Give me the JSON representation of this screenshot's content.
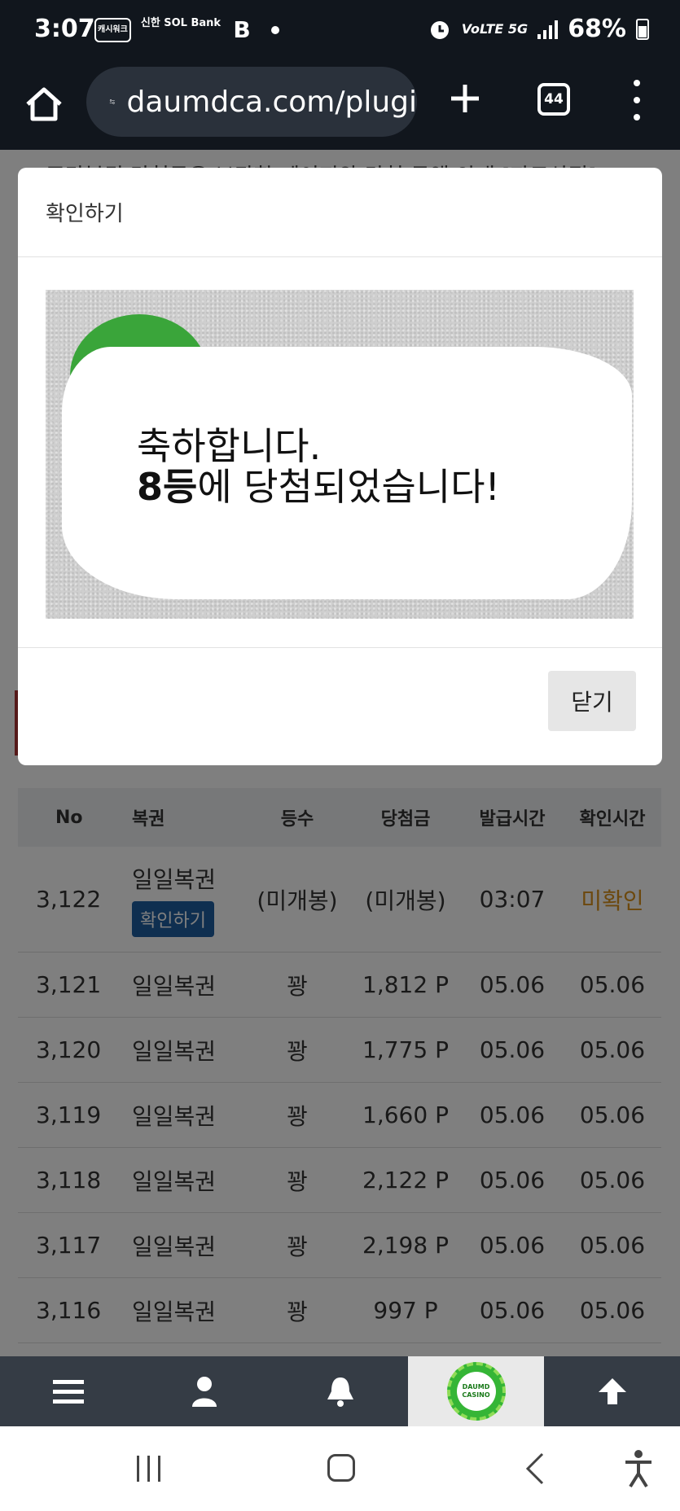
{
  "status_bar": {
    "time": "3:07",
    "app_icons": [
      "캐시워크",
      "신한 SOL Bank",
      "B"
    ],
    "network": "VoLTE 5G",
    "battery": "68%"
  },
  "browser": {
    "url": "daumdca.com/plugi",
    "tab_count": "44"
  },
  "background": {
    "text": "주간복권 당첨금은 보관함 페이지와 당첨 금액 안내 [자료상점]"
  },
  "modal": {
    "title": "확인하기",
    "message_line1": "축하합니다.",
    "message_rank": "8등",
    "message_line2_rest": "에 당첨되었습니다!",
    "close_label": "닫기"
  },
  "table": {
    "headers": [
      "No",
      "복권",
      "등수",
      "당첨금",
      "발급시간",
      "확인시간"
    ],
    "first_row": {
      "no": "3,122",
      "lottery": "일일복권",
      "button": "확인하기",
      "rank": "(미개봉)",
      "prize": "(미개봉)",
      "issued": "03:07",
      "checked": "미확인"
    },
    "rows": [
      {
        "no": "3,121",
        "lottery": "일일복권",
        "rank": "꽝",
        "prize": "1,812 P",
        "issued": "05.06",
        "checked": "05.06"
      },
      {
        "no": "3,120",
        "lottery": "일일복권",
        "rank": "꽝",
        "prize": "1,775 P",
        "issued": "05.06",
        "checked": "05.06"
      },
      {
        "no": "3,119",
        "lottery": "일일복권",
        "rank": "꽝",
        "prize": "1,660 P",
        "issued": "05.06",
        "checked": "05.06"
      },
      {
        "no": "3,118",
        "lottery": "일일복권",
        "rank": "꽝",
        "prize": "2,122 P",
        "issued": "05.06",
        "checked": "05.06"
      },
      {
        "no": "3,117",
        "lottery": "일일복권",
        "rank": "꽝",
        "prize": "2,198 P",
        "issued": "05.06",
        "checked": "05.06"
      },
      {
        "no": "3,116",
        "lottery": "일일복권",
        "rank": "꽝",
        "prize": "997 P",
        "issued": "05.06",
        "checked": "05.06"
      }
    ]
  },
  "bottom_nav": {
    "items": [
      "menu-icon",
      "user-icon",
      "bell-icon",
      "daumd-casino-logo",
      "arrow-up-icon"
    ],
    "logo_text": "DAUMD CASINO"
  },
  "colors": {
    "dark_bar": "#11161d",
    "nav_bg": "#353c45",
    "button_blue": "#1f5fa0",
    "unconfirmed_orange": "#d9901a"
  }
}
